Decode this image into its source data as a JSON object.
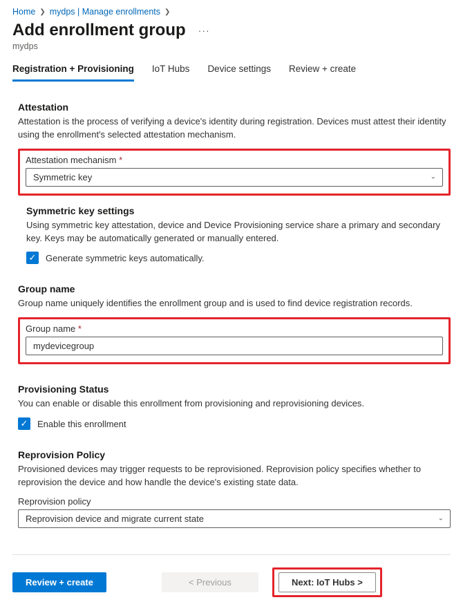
{
  "breadcrumb": {
    "home": "Home",
    "mydps": "mydps | Manage enrollments"
  },
  "header": {
    "title": "Add enrollment group",
    "subtitle": "mydps"
  },
  "tabs": {
    "t0": "Registration + Provisioning",
    "t1": "IoT Hubs",
    "t2": "Device settings",
    "t3": "Review + create"
  },
  "attestation": {
    "title": "Attestation",
    "desc": "Attestation is the process of verifying a device's identity during registration. Devices must attest their identity using the enrollment's selected attestation mechanism.",
    "field_label": "Attestation mechanism",
    "value": "Symmetric key",
    "sub_title": "Symmetric key settings",
    "sub_desc": "Using symmetric key attestation, device and Device Provisioning service share a primary and secondary key. Keys may be automatically generated or manually entered.",
    "checkbox_label": "Generate symmetric keys automatically."
  },
  "group": {
    "title": "Group name",
    "desc": "Group name uniquely identifies the enrollment group and is used to find device registration records.",
    "field_label": "Group name",
    "value": "mydevicegroup"
  },
  "provisioning": {
    "title": "Provisioning Status",
    "desc": "You can enable or disable this enrollment from provisioning and reprovisioning devices.",
    "checkbox_label": "Enable this enrollment"
  },
  "reprovision": {
    "title": "Reprovision Policy",
    "desc": "Provisioned devices may trigger requests to be reprovisioned. Reprovision policy specifies whether to reprovision the device and how handle the device's existing state data.",
    "field_label": "Reprovision policy",
    "value": "Reprovision device and migrate current state"
  },
  "footer": {
    "review": "Review + create",
    "previous": "< Previous",
    "next": "Next: IoT Hubs >"
  },
  "required_mark": "*"
}
